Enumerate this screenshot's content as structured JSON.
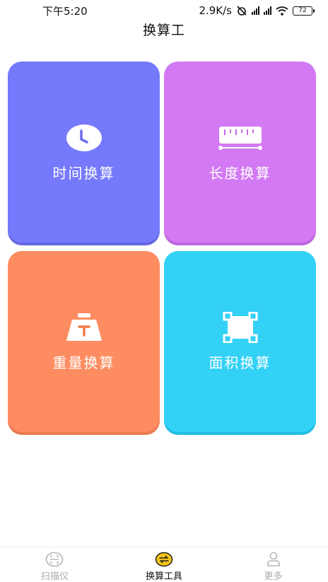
{
  "status_bar": {
    "time": "下午5:20",
    "network_speed": "2.9K/s",
    "battery": "72"
  },
  "page": {
    "title": "换算工"
  },
  "tiles": [
    {
      "label": "时间换算",
      "color": "#7579fb",
      "icon": "clock-icon"
    },
    {
      "label": "长度换算",
      "color": "#d279f3",
      "icon": "ruler-icon"
    },
    {
      "label": "重量换算",
      "color": "#fd8d61",
      "icon": "weight-icon"
    },
    {
      "label": "面积换算",
      "color": "#33d1f6",
      "icon": "area-icon"
    }
  ],
  "bottom_nav": {
    "items": [
      {
        "label": "扫描仪",
        "icon": "scan-icon",
        "active": false
      },
      {
        "label": "换算工具",
        "icon": "convert-icon",
        "active": true
      },
      {
        "label": "更多",
        "icon": "user-icon",
        "active": false
      }
    ],
    "active_color": "#f5c518"
  }
}
